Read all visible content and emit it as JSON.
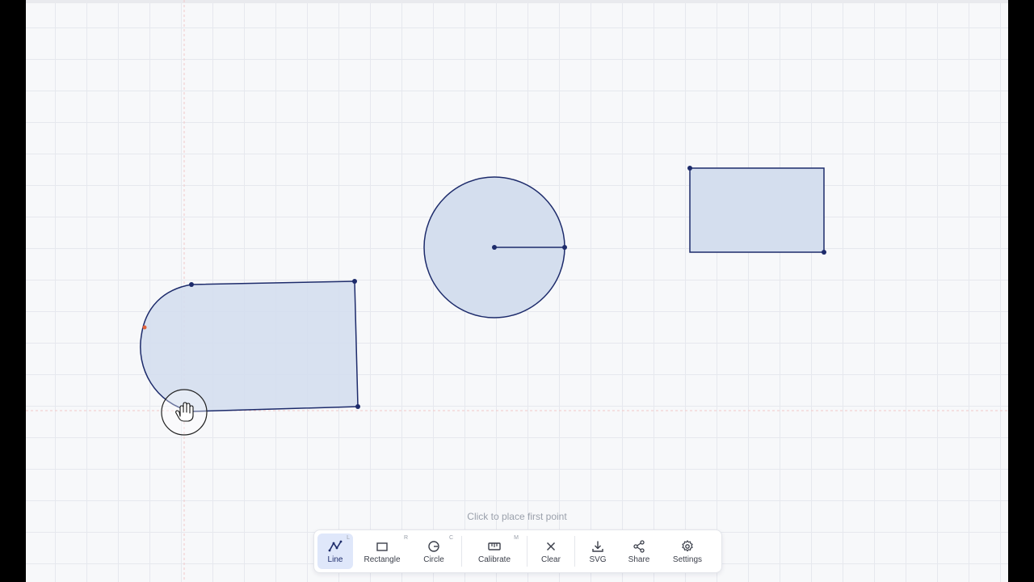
{
  "hint": {
    "text": "Click to place first point"
  },
  "colors": {
    "shape_fill": "#d4deee",
    "shape_stroke": "#1d2b6b",
    "vertex": "#1d2b6b",
    "pending_vertex": "#e0623c",
    "guide_line": "#f1c8c8",
    "active_tool_bg": "#dfe7fa"
  },
  "toolbar": {
    "tools": [
      {
        "label": "Line",
        "shortcut": "L",
        "icon": "polyline-icon",
        "active": true
      },
      {
        "label": "Rectangle",
        "shortcut": "R",
        "icon": "rectangle-icon",
        "active": false
      },
      {
        "label": "Circle",
        "shortcut": "C",
        "icon": "circle-icon",
        "active": false
      },
      {
        "label": "Calibrate",
        "shortcut": "M",
        "icon": "ruler-icon",
        "active": false
      },
      {
        "label": "Clear",
        "shortcut": "",
        "icon": "close-icon",
        "active": false
      },
      {
        "label": "SVG",
        "shortcut": "",
        "icon": "download-icon",
        "active": false
      },
      {
        "label": "Share",
        "shortcut": "",
        "icon": "share-icon",
        "active": false
      },
      {
        "label": "Settings",
        "shortcut": "",
        "icon": "gear-icon",
        "active": false
      }
    ]
  },
  "cursor": {
    "icon": "grab-hand-icon"
  }
}
